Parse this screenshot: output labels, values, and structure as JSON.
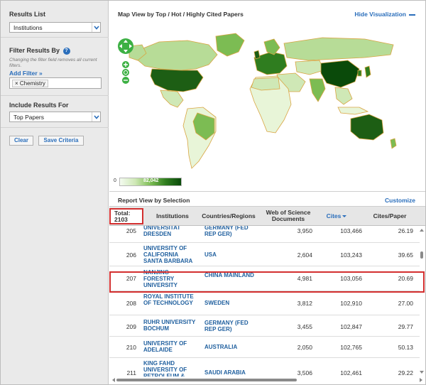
{
  "sidebar": {
    "results_list_label": "Results List",
    "results_list_value": "Institutions",
    "filter_label": "Filter Results By",
    "filter_note": "Changing the filter field removes all current filters.",
    "add_filter": "Add Filter »",
    "filter_chip": "× Chemistry",
    "include_label": "Include Results For",
    "include_value": "Top Papers",
    "clear_button": "Clear",
    "save_button": "Save Criteria"
  },
  "map": {
    "title": "Map View by Top / Hot / Highly Cited Papers",
    "hide_label": "Hide Visualization",
    "legend_min": "0",
    "legend_max": "82,042"
  },
  "report": {
    "title": "Report View by Selection",
    "customize": "Customize",
    "total_label": "Total:",
    "total_value": "2103",
    "columns": {
      "institutions": "Institutions",
      "countries": "Countries/Regions",
      "docs_line1": "Web of Science",
      "docs_line2": "Documents",
      "cites": "Cites",
      "cites_per_paper": "Cites/Paper"
    },
    "rows": [
      {
        "rank": "205",
        "institution": "UNIVERSITAT DRESDEN",
        "country": "GERMANY (FED REP GER)",
        "documents": "3,950",
        "cites": "103,466",
        "cites_per_paper": "26.19"
      },
      {
        "rank": "206",
        "institution": "UNIVERSITY OF CALIFORNIA SANTA BARBARA",
        "country": "USA",
        "documents": "2,604",
        "cites": "103,243",
        "cites_per_paper": "39.65"
      },
      {
        "rank": "207",
        "institution": "NANJING FORESTRY UNIVERSITY",
        "country": "CHINA MAINLAND",
        "documents": "4,981",
        "cites": "103,056",
        "cites_per_paper": "20.69"
      },
      {
        "rank": "208",
        "institution": "ROYAL INSTITUTE OF TECHNOLOGY",
        "country": "SWEDEN",
        "documents": "3,812",
        "cites": "102,910",
        "cites_per_paper": "27.00"
      },
      {
        "rank": "209",
        "institution": "RUHR UNIVERSITY BOCHUM",
        "country": "GERMANY (FED REP GER)",
        "documents": "3,455",
        "cites": "102,847",
        "cites_per_paper": "29.77"
      },
      {
        "rank": "210",
        "institution": "UNIVERSITY OF ADELAIDE",
        "country": "AUSTRALIA",
        "documents": "2,050",
        "cites": "102,765",
        "cites_per_paper": "50.13"
      },
      {
        "rank": "211",
        "institution": "KING FAHD UNIVERSITY OF PETROLEUM & MINERALS",
        "country": "SAUDI ARABIA",
        "documents": "3,506",
        "cites": "102,461",
        "cites_per_paper": "29.22"
      }
    ]
  },
  "colors": {
    "link": "#2a6ebb",
    "highlight": "#d32f2f",
    "map_dark": "#0a4a0a",
    "map_light": "#e8f5d8"
  }
}
